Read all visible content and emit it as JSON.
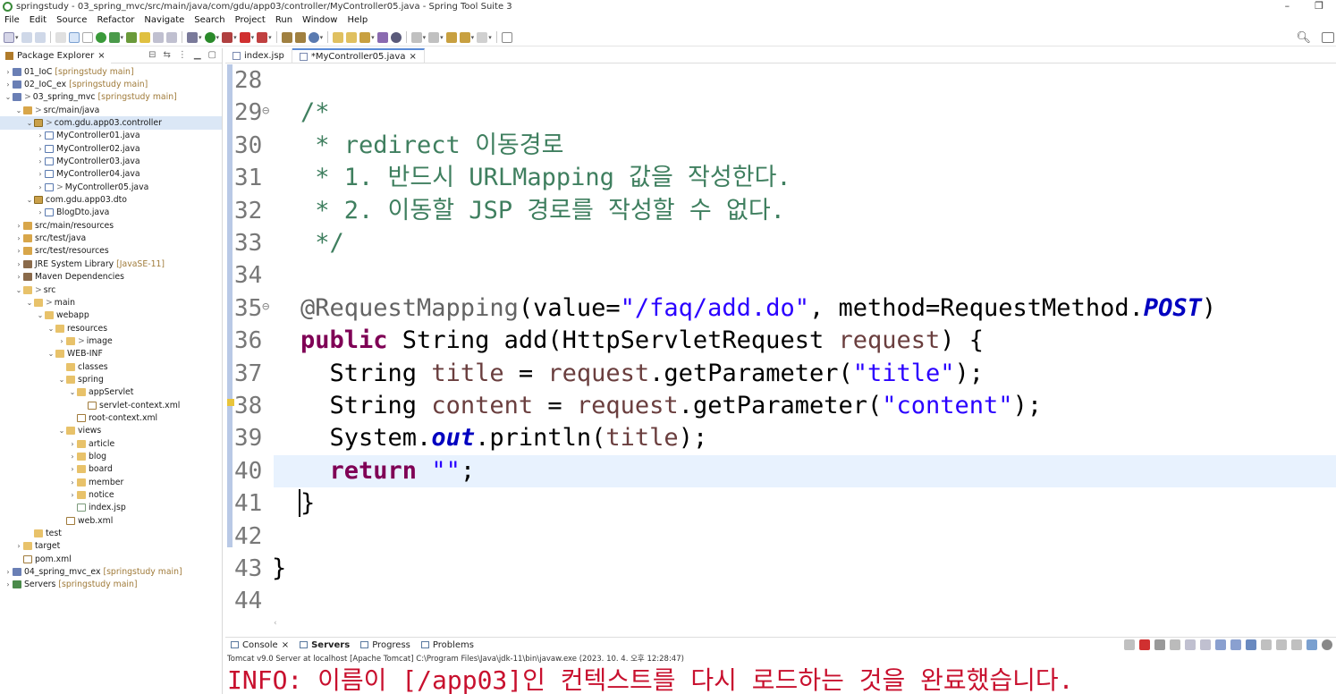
{
  "window": {
    "title": "springstudy - 03_spring_mvc/src/main/java/com/gdu/app03/controller/MyController05.java - Spring Tool Suite 3",
    "minimize": "–",
    "restore": "❐"
  },
  "menu": [
    "File",
    "Edit",
    "Source",
    "Refactor",
    "Navigate",
    "Search",
    "Project",
    "Run",
    "Window",
    "Help"
  ],
  "package_explorer": {
    "title": "Package Explorer",
    "close": "×",
    "items": [
      {
        "label": "01_IoC",
        "suffix": "[springstudy main]",
        "arrow": "›",
        "depth": 0,
        "icon": "project"
      },
      {
        "label": "02_IoC_ex",
        "suffix": "[springstudy main]",
        "arrow": "›",
        "depth": 0,
        "icon": "project"
      },
      {
        "label": "03_spring_mvc",
        "suffix": "[springstudy main]",
        "arrow": "⌄",
        "deco": ">",
        "depth": 0,
        "icon": "project"
      },
      {
        "label": "src/main/java",
        "arrow": "⌄",
        "deco": ">",
        "depth": 1,
        "icon": "srcfolder"
      },
      {
        "label": "com.gdu.app03.controller",
        "arrow": "⌄",
        "deco": ">",
        "depth": 2,
        "icon": "package",
        "selected": true
      },
      {
        "label": "MyController01.java",
        "arrow": "›",
        "depth": 3,
        "icon": "java"
      },
      {
        "label": "MyController02.java",
        "arrow": "›",
        "depth": 3,
        "icon": "java"
      },
      {
        "label": "MyController03.java",
        "arrow": "›",
        "depth": 3,
        "icon": "java"
      },
      {
        "label": "MyController04.java",
        "arrow": "›",
        "depth": 3,
        "icon": "java"
      },
      {
        "label": "MyController05.java",
        "arrow": "›",
        "deco": ">",
        "depth": 3,
        "icon": "java"
      },
      {
        "label": "com.gdu.app03.dto",
        "arrow": "⌄",
        "depth": 2,
        "icon": "package"
      },
      {
        "label": "BlogDto.java",
        "arrow": "›",
        "depth": 3,
        "icon": "java"
      },
      {
        "label": "src/main/resources",
        "arrow": "›",
        "depth": 1,
        "icon": "srcfolder"
      },
      {
        "label": "src/test/java",
        "arrow": "›",
        "depth": 1,
        "icon": "srcfolder"
      },
      {
        "label": "src/test/resources",
        "arrow": "›",
        "depth": 1,
        "icon": "srcfolder"
      },
      {
        "label": "JRE System Library",
        "suffix": "[JavaSE-11]",
        "arrow": "›",
        "depth": 1,
        "icon": "lib"
      },
      {
        "label": "Maven Dependencies",
        "arrow": "›",
        "depth": 1,
        "icon": "lib"
      },
      {
        "label": "src",
        "arrow": "⌄",
        "deco": ">",
        "depth": 1,
        "icon": "folder"
      },
      {
        "label": "main",
        "arrow": "⌄",
        "deco": ">",
        "depth": 2,
        "icon": "folder"
      },
      {
        "label": "webapp",
        "arrow": "⌄",
        "depth": 3,
        "icon": "folder"
      },
      {
        "label": "resources",
        "arrow": "⌄",
        "depth": 4,
        "icon": "folder"
      },
      {
        "label": "image",
        "arrow": "›",
        "deco": ">",
        "depth": 5,
        "icon": "folder"
      },
      {
        "label": "WEB-INF",
        "arrow": "⌄",
        "depth": 4,
        "icon": "folder"
      },
      {
        "label": "classes",
        "arrow": "",
        "depth": 5,
        "icon": "folder"
      },
      {
        "label": "spring",
        "arrow": "⌄",
        "depth": 5,
        "icon": "folder"
      },
      {
        "label": "appServlet",
        "arrow": "⌄",
        "depth": 6,
        "icon": "folder"
      },
      {
        "label": "servlet-context.xml",
        "arrow": "",
        "depth": 7,
        "icon": "xml"
      },
      {
        "label": "root-context.xml",
        "arrow": "",
        "depth": 6,
        "icon": "xml"
      },
      {
        "label": "views",
        "arrow": "⌄",
        "depth": 5,
        "icon": "folder"
      },
      {
        "label": "article",
        "arrow": "›",
        "depth": 6,
        "icon": "folder"
      },
      {
        "label": "blog",
        "arrow": "›",
        "depth": 6,
        "icon": "folder"
      },
      {
        "label": "board",
        "arrow": "›",
        "depth": 6,
        "icon": "folder"
      },
      {
        "label": "member",
        "arrow": "›",
        "depth": 6,
        "icon": "folder"
      },
      {
        "label": "notice",
        "arrow": "›",
        "depth": 6,
        "icon": "folder"
      },
      {
        "label": "index.jsp",
        "arrow": "",
        "depth": 6,
        "icon": "jsp"
      },
      {
        "label": "web.xml",
        "arrow": "",
        "depth": 5,
        "icon": "xml"
      },
      {
        "label": "test",
        "arrow": "",
        "depth": 2,
        "icon": "folder"
      },
      {
        "label": "target",
        "arrow": "›",
        "depth": 1,
        "icon": "folder"
      },
      {
        "label": "pom.xml",
        "arrow": "",
        "depth": 1,
        "icon": "xml"
      },
      {
        "label": "04_spring_mvc_ex",
        "suffix": "[springstudy main]",
        "arrow": "›",
        "depth": 0,
        "icon": "project"
      },
      {
        "label": "Servers",
        "suffix": "[springstudy main]",
        "arrow": "›",
        "depth": 0,
        "icon": "server"
      }
    ]
  },
  "editor_tabs": [
    {
      "label": "index.jsp",
      "active": false
    },
    {
      "label": "*MyController05.java",
      "active": true,
      "close": "×"
    }
  ],
  "code_lines": [
    {
      "num": "28",
      "fold": "",
      "html": ""
    },
    {
      "num": "29",
      "fold": "⊖",
      "html": "<span class=\"c-comment\">/*</span>"
    },
    {
      "num": "30",
      "fold": "",
      "html": "<span class=\"c-comment\"> * redirect 이동경로</span>"
    },
    {
      "num": "31",
      "fold": "",
      "html": "<span class=\"c-comment\"> * 1. 반드시 URLMapping 값을 작성한다.</span>"
    },
    {
      "num": "32",
      "fold": "",
      "html": "<span class=\"c-comment\"> * 2. 이동할 JSP 경로를 작성할 수 없다.</span>"
    },
    {
      "num": "33",
      "fold": "",
      "html": "<span class=\"c-comment\"> */</span>"
    },
    {
      "num": "34",
      "fold": "",
      "html": ""
    },
    {
      "num": "35",
      "fold": "⊖",
      "html": "<span class=\"c-ann\">@RequestMapping</span><span class=\"c-plain\">(value=</span><span class=\"c-str\">\"/faq/add.do\"</span><span class=\"c-plain\">, method=RequestMethod.</span><span class=\"c-field\">POST</span><span class=\"c-plain\">)</span>"
    },
    {
      "num": "36",
      "fold": "",
      "html": "<span class=\"c-kw\">public</span><span class=\"c-plain\"> String add(HttpServletRequest </span><span class=\"c-var\">request</span><span class=\"c-plain\">) {</span>"
    },
    {
      "num": "37",
      "fold": "",
      "html": "<span class=\"c-plain\">  String </span><span class=\"c-var\">title</span><span class=\"c-plain\"> = </span><span class=\"c-var\">request</span><span class=\"c-plain\">.getParameter(</span><span class=\"c-str\">\"title\"</span><span class=\"c-plain\">);</span>"
    },
    {
      "num": "38",
      "fold": "",
      "html": "<span class=\"c-plain\">  String </span><span class=\"c-var\">content</span><span class=\"c-plain\"> = </span><span class=\"c-var\">request</span><span class=\"c-plain\">.getParameter(</span><span class=\"c-str\">\"content\"</span><span class=\"c-plain\">);</span>"
    },
    {
      "num": "39",
      "fold": "",
      "html": "<span class=\"c-plain\">  System.</span><span class=\"c-field\">out</span><span class=\"c-plain\">.println(</span><span class=\"c-var\">title</span><span class=\"c-plain\">);</span>"
    },
    {
      "num": "40",
      "fold": "",
      "html": "<span class=\"c-plain\">  </span><span class=\"c-kw\">return</span><span class=\"c-plain\"> </span><span class=\"c-str\">\"\"</span><span class=\"c-plain\">;</span>",
      "current": true
    },
    {
      "num": "41",
      "fold": "",
      "html": "<span class=\"c-cursor\"></span><span class=\"c-plain\">}</span>"
    },
    {
      "num": "42",
      "fold": "",
      "html": ""
    },
    {
      "num": "43",
      "fold": "",
      "html": "<span class=\"c-plain\">}</span>",
      "outdent": true
    },
    {
      "num": "44",
      "fold": "",
      "html": ""
    }
  ],
  "console_tabs": [
    {
      "label": "Console",
      "close": "×",
      "bold": false
    },
    {
      "label": "Servers",
      "bold": true
    },
    {
      "label": "Progress",
      "bold": false
    },
    {
      "label": "Problems",
      "bold": false
    }
  ],
  "console": {
    "description": "Tomcat v9.0 Server at localhost [Apache Tomcat] C:\\Program Files\\Java\\jdk-11\\bin\\javaw.exe  (2023. 10. 4. 오후 12:28:47)",
    "output": "INFO: 이름이 [/app03]인 컨텍스트를 다시 로드하는 것을 완료했습니다."
  },
  "colors": {
    "comment": "#3f7f5f",
    "keyword": "#7f0055",
    "string": "#2a00ff",
    "error_text": "#c8102e",
    "current_line": "#e8f2fe"
  }
}
